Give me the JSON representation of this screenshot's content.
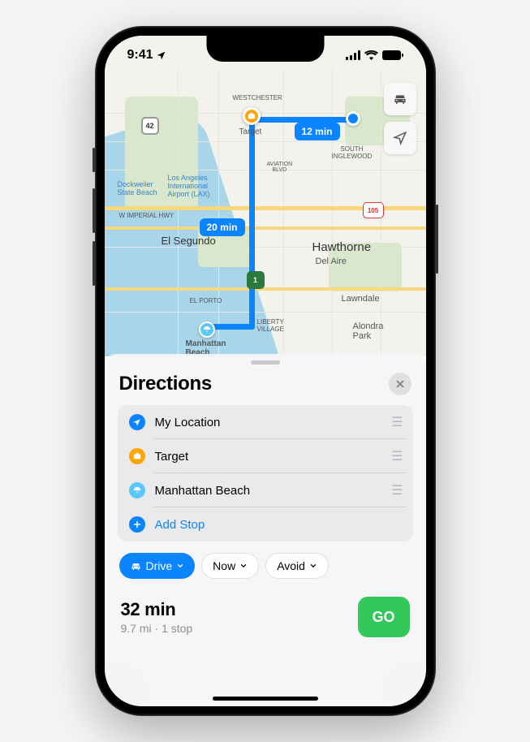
{
  "status": {
    "time": "9:41"
  },
  "map": {
    "eta1": "12 min",
    "eta2": "20 min",
    "pin_target": "Target",
    "pin_beach": "Manhattan\nBeach",
    "labels": {
      "westchester": "WESTCHESTER",
      "south_inglewood": "SOUTH\nINGLEWOOD",
      "aviation": "AVIATION\nBLVD",
      "dockweiler": "Dockweiler\nState Beach",
      "lax": "Los Angeles\nInternational\nAirport (LAX)",
      "imperial": "W IMPERIAL HWY",
      "el_segundo": "El Segundo",
      "hawthorne": "Hawthorne",
      "del_aire": "Del Aire",
      "el_porto": "EL PORTO",
      "lawndale": "Lawndale",
      "liberty": "LIBERTY\nVILLAGE",
      "alondra": "Alondra\nPark",
      "hwy42": "42",
      "hwy1": "1",
      "hwy105": "105"
    }
  },
  "sheet": {
    "title": "Directions",
    "stops": [
      {
        "label": "My Location"
      },
      {
        "label": "Target"
      },
      {
        "label": "Manhattan Beach"
      }
    ],
    "add_stop": "Add Stop",
    "options": {
      "drive": "Drive",
      "depart": "Now",
      "avoid": "Avoid"
    },
    "summary": {
      "time": "32 min",
      "sub": "9.7 mi · 1 stop"
    },
    "go": "GO"
  }
}
